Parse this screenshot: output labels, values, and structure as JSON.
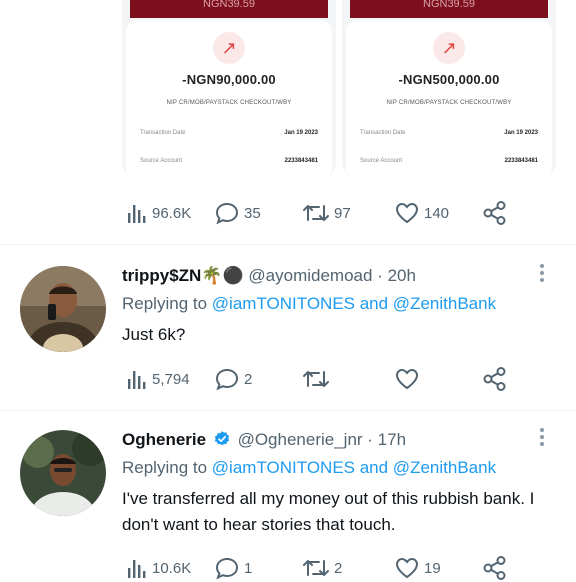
{
  "receipts": [
    {
      "banner": "NGN39.59",
      "icon": "arrow-up-right-icon",
      "amount": "-NGN90,000.00",
      "description": "NIP CR/MOB/PAYSTACK CHECKOUT/WBY",
      "rows": [
        {
          "label": "Transaction Date",
          "value": "Jan 19 2023"
        },
        {
          "label": "Source Account",
          "value": "2233843481"
        }
      ]
    },
    {
      "banner": "NGN39.59",
      "icon": "arrow-up-right-icon",
      "amount": "-NGN500,000.00",
      "description": "NIP CR/MOB/PAYSTACK CHECKOUT/WBY",
      "rows": [
        {
          "label": "Transaction Date",
          "value": "Jan 19 2023"
        },
        {
          "label": "Source Account",
          "value": "2233843481"
        }
      ]
    }
  ],
  "tweet_actions": {
    "views": "96.6K",
    "replies": "35",
    "retweets": "97",
    "likes": "140"
  },
  "replies": [
    {
      "name": "trippy$ZN🌴⚫",
      "handle": "@ayomidemoad",
      "time": "· 20h",
      "replying_prefix": "Replying to",
      "replying_to": "@iamTONITONES and @ZenithBank",
      "text": "Just 6k?",
      "views": "5,794",
      "replies": "2",
      "retweets": "",
      "likes": ""
    },
    {
      "name": "Oghenerie",
      "verified": true,
      "handle": "@Oghenerie_jnr",
      "time": "· 17h",
      "replying_prefix": "Replying to",
      "replying_to": "@iamTONITONES and @ZenithBank",
      "text": "I've transferred all my money out of this rubbish bank. I don't want to hear stories that touch.",
      "views": "10.6K",
      "replies": "1",
      "retweets": "2",
      "likes": "19"
    }
  ],
  "colors": {
    "accent": "#1d9bf0",
    "muted": "#536471",
    "banner": "#7d0f1d",
    "debit_red": "#e0453f",
    "verified": "#1d9bf0"
  }
}
